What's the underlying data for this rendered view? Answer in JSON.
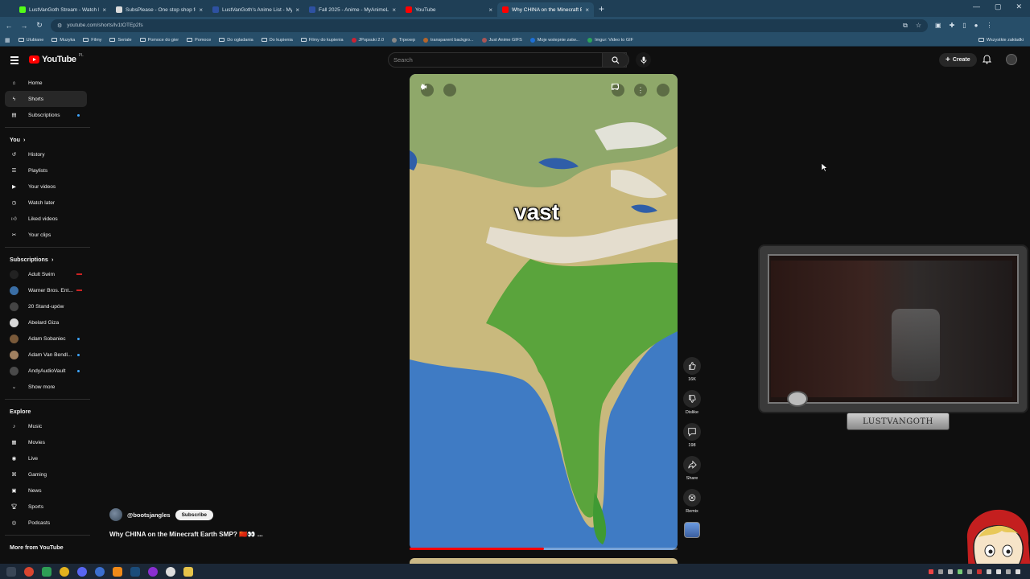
{
  "browser": {
    "tabs": [
      {
        "title": "LustVanGoth Stream - Watch L",
        "favicon_color": "#53fc18",
        "active": false
      },
      {
        "title": "SubsPlease - One stop shop fo",
        "favicon_color": "#dcdcdc",
        "active": false
      },
      {
        "title": "LustVanGoth's Anime List - My",
        "favicon_color": "#2e51a2",
        "active": false
      },
      {
        "title": "Fall 2025 - Anime - MyAnimeLi",
        "favicon_color": "#2e51a2",
        "active": false
      },
      {
        "title": "YouTube",
        "favicon_color": "#ff0000",
        "active": false
      },
      {
        "title": "Why CHINA on the Minecraft E",
        "favicon_color": "#ff0000",
        "active": true
      }
    ],
    "url": "youtube.com/shorts/lv1tOTEp2fs",
    "bookmarks": [
      {
        "label": "Ulubiane",
        "type": "folder"
      },
      {
        "label": "Muzyka",
        "type": "folder"
      },
      {
        "label": "Filmy",
        "type": "folder"
      },
      {
        "label": "Seriale",
        "type": "folder"
      },
      {
        "label": "Pomoce do gier",
        "type": "folder"
      },
      {
        "label": "Pomoce",
        "type": "folder"
      },
      {
        "label": "Do ogladania",
        "type": "folder"
      },
      {
        "label": "Do kupienia",
        "type": "folder"
      },
      {
        "label": "Filmy do kupienia",
        "type": "folder"
      },
      {
        "label": "JPopsuki 2.0",
        "type": "site",
        "color": "#c23"
      },
      {
        "label": "Trpexep",
        "type": "site",
        "color": "#888"
      },
      {
        "label": "transparent backgro...",
        "type": "site",
        "color": "#b5652b"
      },
      {
        "label": "Just Anime GIFS",
        "type": "site",
        "color": "#a55"
      },
      {
        "label": "Moje wstepnie zatw...",
        "type": "site",
        "color": "#1d6fd6"
      },
      {
        "label": "Imgur: Video to GIF",
        "type": "site",
        "color": "#2ca35a"
      }
    ],
    "bookmarks_right": "Wszystkie zakładki"
  },
  "youtube": {
    "logo_text": "YouTube",
    "country_code": "PL",
    "search_placeholder": "Search",
    "create_label": "Create",
    "sidebar": {
      "main": [
        {
          "label": "Home",
          "icon": "home-icon",
          "active": false
        },
        {
          "label": "Shorts",
          "icon": "shorts-icon",
          "active": true
        },
        {
          "label": "Subscriptions",
          "icon": "subscriptions-icon",
          "active": false
        }
      ],
      "you_title": "You",
      "you": [
        {
          "label": "History",
          "icon": "history-icon"
        },
        {
          "label": "Playlists",
          "icon": "playlists-icon"
        },
        {
          "label": "Your videos",
          "icon": "your-videos-icon"
        },
        {
          "label": "Watch later",
          "icon": "watch-later-icon"
        },
        {
          "label": "Liked videos",
          "icon": "liked-icon"
        },
        {
          "label": "Your clips",
          "icon": "scissors-icon"
        }
      ],
      "subscriptions_title": "Subscriptions",
      "subscriptions": [
        {
          "label": "Adult Swim",
          "avatar_color": "#222",
          "live": true
        },
        {
          "label": "Warner Bros. Ent...",
          "avatar_color": "#3a6ea5",
          "live": true
        },
        {
          "label": "20 Stand-upów",
          "avatar_color": "#444",
          "live": false
        },
        {
          "label": "Abelard Giza",
          "avatar_color": "#d8d8d8",
          "live": false
        },
        {
          "label": "Adam Sobaniec",
          "avatar_color": "#7a5a3a",
          "live": false,
          "dot": true
        },
        {
          "label": "Adam Van Bendl...",
          "avatar_color": "#a08060",
          "live": false,
          "dot": true
        },
        {
          "label": "AndyAudioVault",
          "avatar_color": "#4a4a4a",
          "live": false,
          "dot": true
        }
      ],
      "show_more": "Show more",
      "explore_title": "Explore",
      "explore": [
        {
          "label": "Music",
          "icon": "music-icon"
        },
        {
          "label": "Movies",
          "icon": "movies-icon"
        },
        {
          "label": "Live",
          "icon": "live-icon"
        },
        {
          "label": "Gaming",
          "icon": "gaming-icon"
        },
        {
          "label": "News",
          "icon": "news-icon"
        },
        {
          "label": "Sports",
          "icon": "sports-icon"
        },
        {
          "label": "Podcasts",
          "icon": "podcasts-icon"
        }
      ],
      "more_from": "More from YouTube"
    },
    "short": {
      "caption": "vast",
      "progress": 0.5,
      "channel": "@bootsjangles",
      "subscribe_label": "Subscribe",
      "title": "Why CHINA on the Minecraft Earth SMP? 🇨🇳👀 ...",
      "actions": [
        {
          "icon": "like-icon",
          "label": "16K"
        },
        {
          "icon": "dislike-icon",
          "label": "Dislike"
        },
        {
          "icon": "comment-icon",
          "label": "198"
        },
        {
          "icon": "share-icon",
          "label": "Share"
        },
        {
          "icon": "remix-icon",
          "label": "Remix"
        }
      ]
    }
  },
  "overlay": {
    "nameplate": "LUSTVANGOTH"
  }
}
